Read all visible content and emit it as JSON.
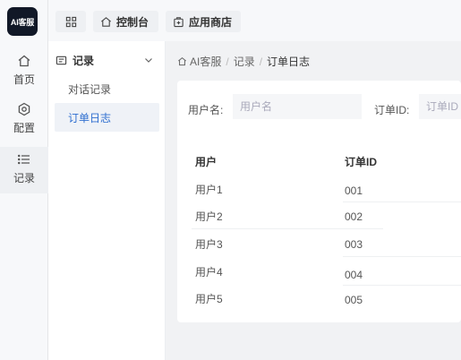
{
  "rail": {
    "logo_text": "AI客服",
    "items": [
      {
        "label": "首页",
        "icon": "home-icon"
      },
      {
        "label": "配置",
        "icon": "settings-icon"
      },
      {
        "label": "记录",
        "icon": "list-icon"
      }
    ]
  },
  "topbar": {
    "tabs": [
      {
        "label": "",
        "icon": "grid-icon"
      },
      {
        "label": "控制台",
        "icon": "home-icon"
      },
      {
        "label": "应用商店",
        "icon": "store-icon"
      }
    ]
  },
  "submenu": {
    "title": "记录",
    "items": [
      {
        "label": "对话记录"
      },
      {
        "label": "订单日志"
      }
    ]
  },
  "breadcrumb": [
    "AI客服",
    "记录",
    "订单日志"
  ],
  "filters": {
    "user_label": "用户名:",
    "user_placeholder": "用户名",
    "order_label": "订单ID:",
    "order_placeholder": "订单ID"
  },
  "table": {
    "headers": [
      "用户",
      "订单ID"
    ],
    "rows": [
      [
        "用户1",
        "001"
      ],
      [
        "用户2",
        "002"
      ],
      [
        "用户3",
        "003"
      ],
      [
        "用户4",
        "004"
      ],
      [
        "用户5",
        "005"
      ]
    ]
  },
  "colors": {
    "active_text": "#2f6fd0",
    "active_bg": "#eff2f7",
    "logo_bg": "#111827"
  }
}
